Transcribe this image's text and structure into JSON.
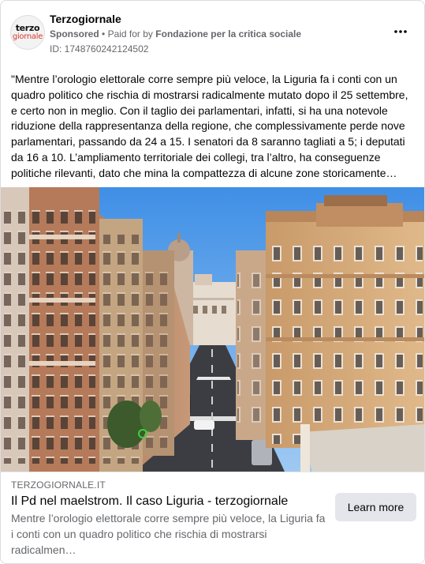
{
  "post": {
    "page_name": "Terzogiornale",
    "avatar_text_top": "terzo",
    "avatar_text_bottom": "giornale",
    "sponsored_label": "Sponsored",
    "separator": "•",
    "paid_for_prefix": "Paid for by",
    "payer": "Fondazione per la critica sociale",
    "ad_id": "ID: 1748760242124502",
    "more_icon": "more-horizontal-icon",
    "body_text": "\"Mentre l’orologio elettorale corre sempre più veloce, la Liguria fa i conti con un quadro politico che rischia di mostrarsi radicalmente mutato dopo il 25 settembre, e certo non in meglio. Con il taglio dei parlamentari, infatti, si ha una notevole riduzione della rappresentanza della regione, che complessivamente perde nove parlamentari, passando da 24 a 15. I senatori da 8 saranno tagliati a 5; i deputati da 16 a 10. L’ampliamento territoriale dei collegi, tra l’altro, ha conseguenze politiche rilevanti, dato che mina la compattezza di alcune zone storicamente…"
  },
  "link": {
    "domain": "TERZOGIORNALE.IT",
    "title": "Il Pd nel maelstrom. Il caso Liguria - terzogiornale",
    "description": "Mentre l’orologio elettorale corre sempre più veloce, la Liguria fa i conti con un quadro politico che rischia di mostrarsi radicalmen…",
    "cta_label": "Learn more"
  },
  "colors": {
    "secondary_text": "#65676b",
    "button_bg": "#e4e6eb",
    "border": "#dadde1"
  }
}
